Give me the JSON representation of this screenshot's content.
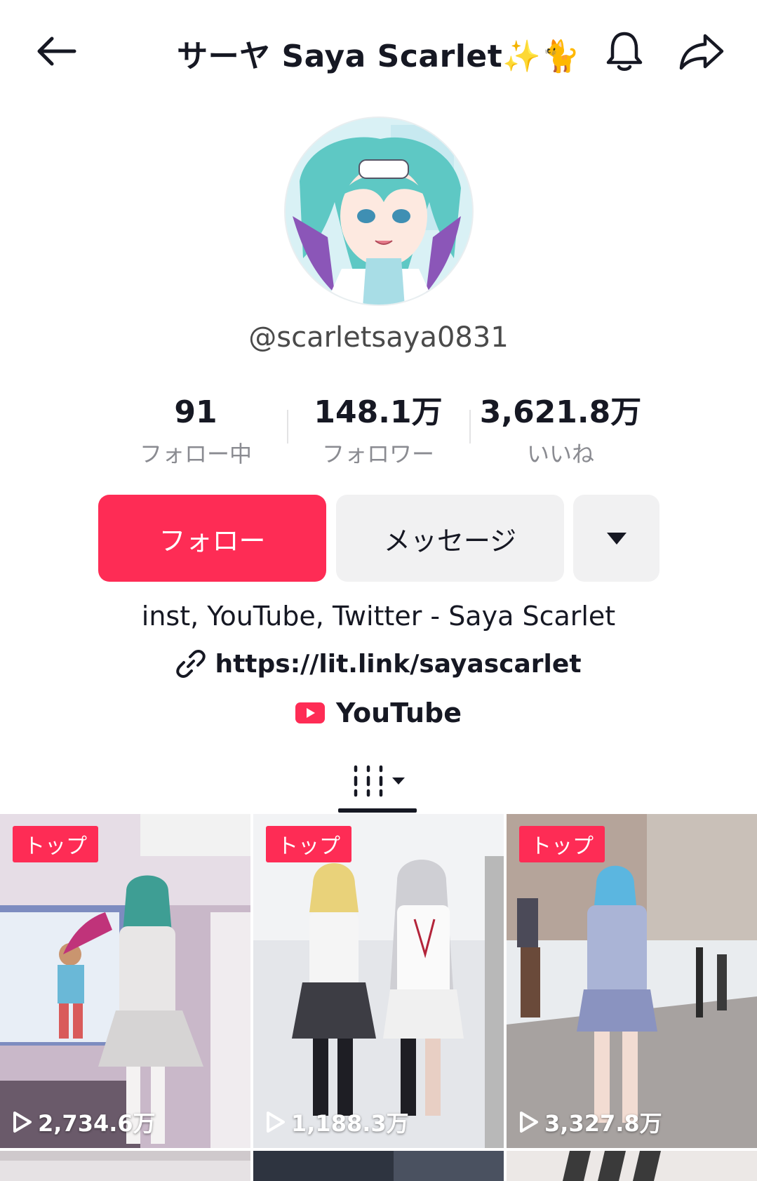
{
  "header": {
    "title": "サーヤ Saya Scarlet✨🐈"
  },
  "profile": {
    "handle": "@scarletsaya0831",
    "stats": [
      {
        "value": "91",
        "label": "フォロー中"
      },
      {
        "value": "148.1万",
        "label": "フォロワー"
      },
      {
        "value": "3,621.8万",
        "label": "いいね"
      }
    ],
    "actions": {
      "follow_label": "フォロー",
      "message_label": "メッセージ"
    },
    "bio": "inst, YouTube, Twitter - Saya Scarlet",
    "link": "https://lit.link/sayascarlet",
    "youtube_label": "YouTube"
  },
  "videos": [
    {
      "badge": "トップ",
      "views": "2,734.6万"
    },
    {
      "badge": "トップ",
      "views": "1,188.3万"
    },
    {
      "badge": "トップ",
      "views": "3,327.8万"
    }
  ],
  "colors": {
    "accent": "#fe2c55",
    "text": "#161823",
    "muted": "#8a8b91",
    "button_gray": "#f1f1f2"
  }
}
